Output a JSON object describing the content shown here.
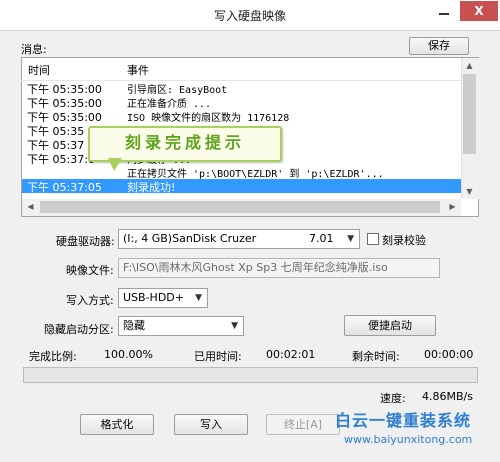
{
  "window": {
    "title": "写入硬盘映像",
    "close_label": "X"
  },
  "messages": {
    "label": "消息:",
    "save_button": "保存",
    "columns": {
      "time": "时间",
      "event": "事件"
    },
    "rows": [
      {
        "time": "下午 05:35:00",
        "event": "引导扇区: EasyBoot"
      },
      {
        "time": "下午 05:35:00",
        "event": "正在准备介质 ..."
      },
      {
        "time": "下午 05:35:00",
        "event": "ISO 映像文件的扇区数为 1176128"
      },
      {
        "time": "下午 05:35",
        "event": ""
      },
      {
        "time": "下午 05:37",
        "event": ""
      },
      {
        "time": "下午 05:37:0",
        "event": "同步缓存 ..."
      },
      {
        "time": "",
        "event": "正在拷贝文件 'p:\\BOOT\\EZLDR' 到 'p:\\EZLDR'..."
      },
      {
        "time": "下午 05:37:05",
        "event": "刻录成功!"
      }
    ],
    "selected_index": 7
  },
  "callout": {
    "text": "刻录完成提示"
  },
  "drive": {
    "label": "硬盘驱动器:",
    "value": "(I:, 4 GB)SanDisk Cruzer",
    "version": "7.01",
    "verify_label": "刻录校验",
    "verify_checked": false
  },
  "image_file": {
    "label": "映像文件:",
    "value": "F:\\ISO\\雨林木风Ghost Xp Sp3 七周年纪念纯净版.iso"
  },
  "write_mode": {
    "label": "写入方式:",
    "value": "USB-HDD+"
  },
  "hidden_partition": {
    "label": "隐藏启动分区:",
    "value": "隐藏",
    "quick_boot_button": "便捷启动"
  },
  "stats": {
    "complete_label": "完成比例:",
    "complete_value": "100.00%",
    "elapsed_label": "已用时间:",
    "elapsed_value": "00:02:01",
    "remaining_label": "剩余时间:",
    "remaining_value": "00:00:00",
    "speed_label": "速度:",
    "speed_value": "4.86MB/s"
  },
  "progress": {
    "percent": 100
  },
  "buttons": {
    "format": "格式化",
    "write": "写入",
    "terminate": "终止[A]"
  },
  "watermark": {
    "title": "白云一键重装系统",
    "url": "www.baiyunxitong.com"
  },
  "colors": {
    "selection": "#3399ff",
    "callout_border": "#a7d15c",
    "callout_text": "#5ea31e",
    "watermark": "#2f7fd4",
    "close_button": "#c75050"
  }
}
